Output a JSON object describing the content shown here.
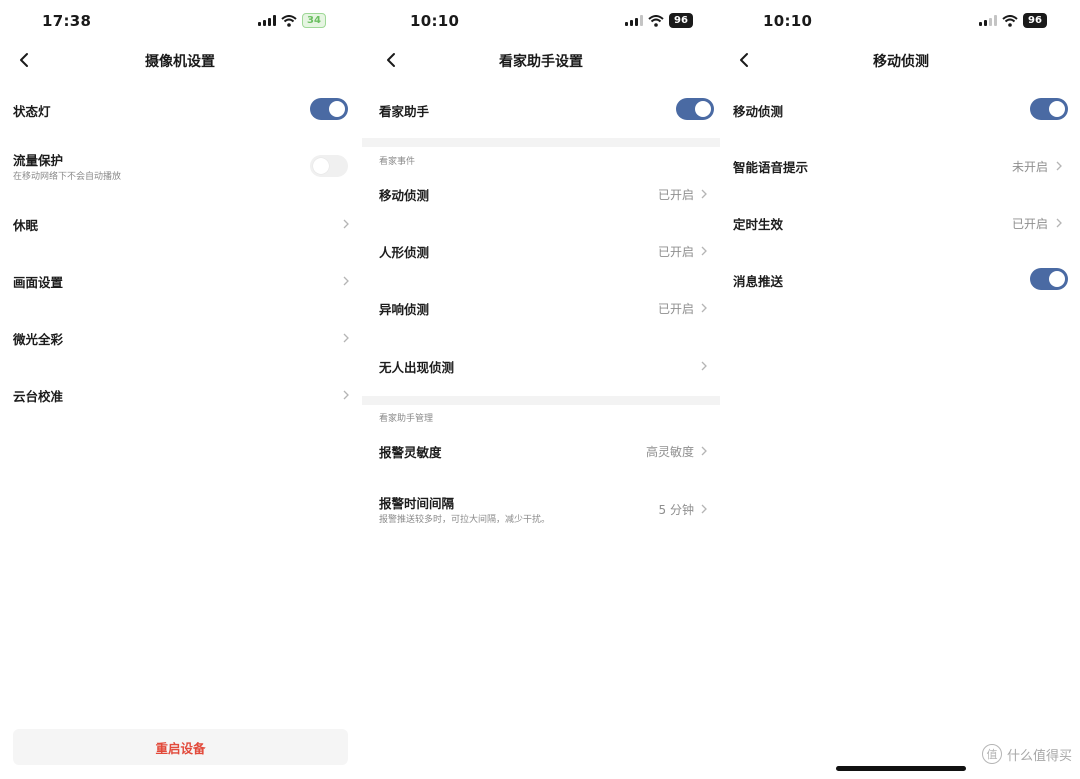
{
  "panels": [
    {
      "status": {
        "time": "17:38",
        "battery": "34"
      },
      "title": "摄像机设置",
      "items": [
        {
          "label": "状态灯",
          "control": "toggle",
          "on": true
        },
        {
          "label": "流量保护",
          "sub": "在移动网络下不会自动播放",
          "control": "toggle",
          "on": false
        },
        {
          "label": "休眠",
          "control": "chevron"
        },
        {
          "label": "画面设置",
          "control": "chevron"
        },
        {
          "label": "微光全彩",
          "control": "chevron"
        },
        {
          "label": "云台校准",
          "control": "chevron"
        }
      ],
      "restart_label": "重启设备"
    },
    {
      "status": {
        "time": "10:10",
        "battery": "96"
      },
      "title": "看家助手设置",
      "master": {
        "label": "看家助手",
        "on": true
      },
      "sections": [
        {
          "label": "看家事件",
          "items": [
            {
              "label": "移动侦测",
              "value": "已开启"
            },
            {
              "label": "人形侦测",
              "value": "已开启"
            },
            {
              "label": "异响侦测",
              "value": "已开启"
            },
            {
              "label": "无人出现侦测",
              "value": ""
            }
          ]
        },
        {
          "label": "看家助手管理",
          "items": [
            {
              "label": "报警灵敏度",
              "value": "高灵敏度"
            },
            {
              "label": "报警时间间隔",
              "sub": "报警推送较多时，可拉大间隔，减少干扰。",
              "value": "5 分钟"
            }
          ]
        }
      ]
    },
    {
      "status": {
        "time": "10:10",
        "battery": "96"
      },
      "title": "移动侦测",
      "items": [
        {
          "label": "移动侦测",
          "control": "toggle",
          "on": true
        },
        {
          "label": "智能语音提示",
          "control": "value",
          "value": "未开启"
        },
        {
          "label": "定时生效",
          "control": "value",
          "value": "已开启"
        },
        {
          "label": "消息推送",
          "control": "toggle",
          "on": true
        }
      ]
    }
  ],
  "watermark": {
    "text": "什么值得买",
    "logo_glyph": "值"
  },
  "colors": {
    "toggle_on": "#4a6aa3",
    "toggle_off": "#f0f0f0",
    "restart_text": "#e24a3b",
    "value_text": "#8f8f8f"
  },
  "icons": [
    "chevron-left-icon",
    "chevron-right-icon",
    "signal-icon",
    "wifi-icon",
    "battery-icon"
  ]
}
